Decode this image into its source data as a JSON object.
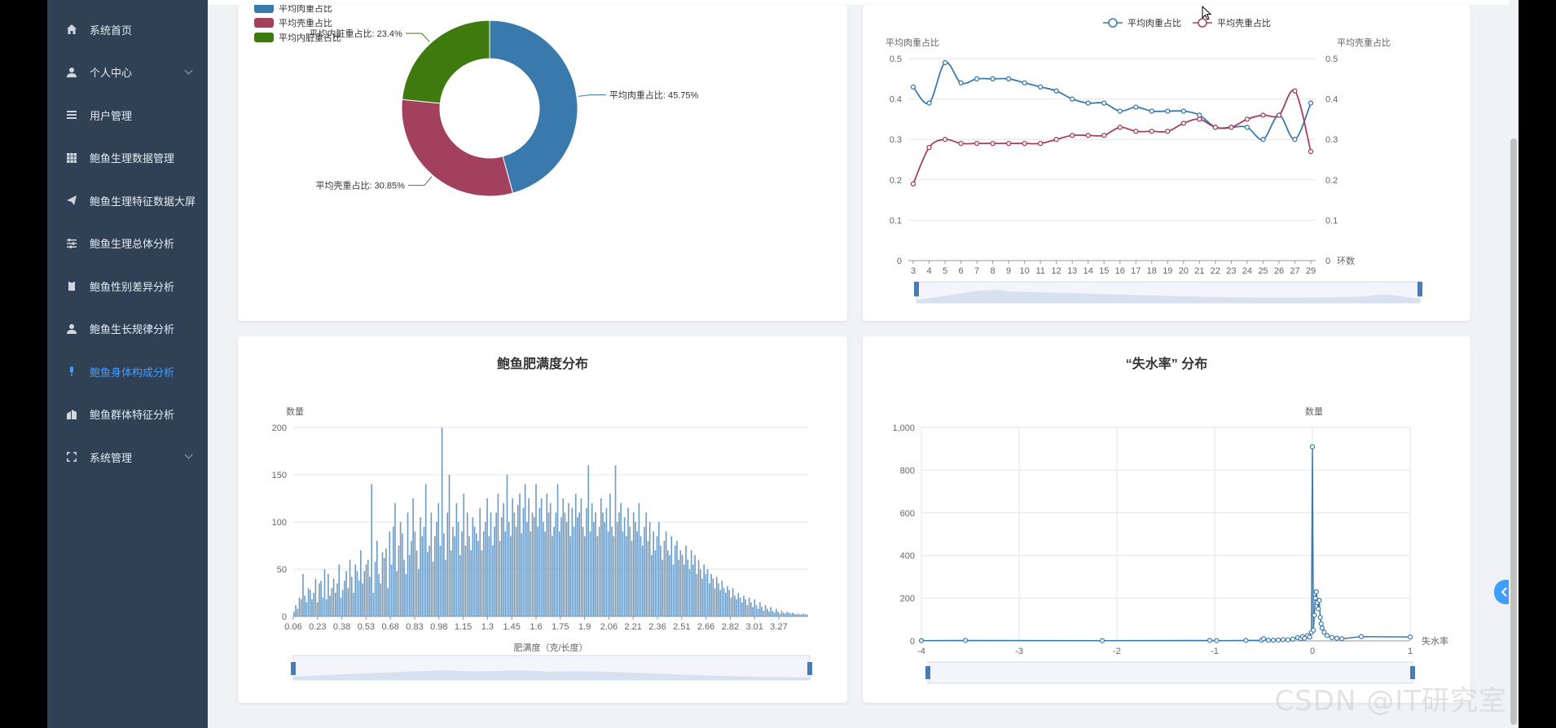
{
  "sidebar": {
    "items": [
      {
        "label": "系统首页",
        "icon": "home-icon",
        "active": false,
        "expandable": false
      },
      {
        "label": "个人中心",
        "icon": "user-icon",
        "active": false,
        "expandable": true
      },
      {
        "label": "用户管理",
        "icon": "list-icon",
        "active": false,
        "expandable": false
      },
      {
        "label": "鲍鱼生理数据管理",
        "icon": "grid-icon",
        "active": false,
        "expandable": false
      },
      {
        "label": "鲍鱼生理特征数据大屏",
        "icon": "paper-plane-icon",
        "active": false,
        "expandable": false
      },
      {
        "label": "鲍鱼生理总体分析",
        "icon": "sliders-icon",
        "active": false,
        "expandable": false
      },
      {
        "label": "鲍鱼性别差异分析",
        "icon": "clipboard-icon",
        "active": false,
        "expandable": false
      },
      {
        "label": "鲍鱼生长规律分析",
        "icon": "user-icon",
        "active": false,
        "expandable": false
      },
      {
        "label": "鲍鱼身体构成分析",
        "icon": "microphone-icon",
        "active": true,
        "expandable": false
      },
      {
        "label": "鲍鱼群体特征分析",
        "icon": "building-icon",
        "active": false,
        "expandable": false
      },
      {
        "label": "系统管理",
        "icon": "fullscreen-icon",
        "active": false,
        "expandable": true
      }
    ]
  },
  "colors": {
    "sidebar_bg": "#304156",
    "accent": "#409EFF",
    "series_blue": "#3a79ab",
    "series_red": "#a3405e",
    "series_green": "#3f7a0f"
  },
  "charts": {
    "pie": {
      "legend": [
        "平均肉重占比",
        "平均壳重占比",
        "平均内脏重占比"
      ]
    },
    "line": {
      "legend": [
        "平均肉重占比",
        "平均壳重占比"
      ],
      "y_left_label": "平均肉重占比",
      "y_right_label": "平均壳重占比",
      "x_axis_label": "环数"
    },
    "hist": {
      "title": "鲍鱼肥满度分布",
      "ylabel": "数量",
      "xlabel": "肥满度（克/长度）"
    },
    "scatter": {
      "title": "“失水率” 分布",
      "ylabel": "数量",
      "xlabel": "失水率"
    }
  },
  "chart_data": [
    {
      "type": "pie",
      "slices": [
        {
          "name": "平均肉重占比",
          "value": 45.75,
          "label": "平均肉重占比: 45.75%"
        },
        {
          "name": "平均壳重占比",
          "value": 30.85,
          "label": "平均壳重占比: 30.85%"
        },
        {
          "name": "平均内脏重占比",
          "value": 23.4,
          "label": "平均内脏重占比: 23.4%"
        }
      ]
    },
    {
      "type": "line",
      "x": [
        "3",
        "4",
        "5",
        "6",
        "7",
        "8",
        "9",
        "10",
        "11",
        "12",
        "13",
        "14",
        "15",
        "16",
        "17",
        "18",
        "19",
        "20",
        "21",
        "22",
        "23",
        "24",
        "25",
        "26",
        "27",
        "29"
      ],
      "series": [
        {
          "name": "平均肉重占比",
          "values": [
            0.43,
            0.39,
            0.49,
            0.44,
            0.45,
            0.45,
            0.45,
            0.44,
            0.43,
            0.42,
            0.4,
            0.39,
            0.39,
            0.37,
            0.38,
            0.37,
            0.37,
            0.37,
            0.36,
            0.33,
            0.33,
            0.33,
            0.3,
            0.36,
            0.3,
            0.39
          ]
        },
        {
          "name": "平均壳重占比",
          "values": [
            0.19,
            0.28,
            0.3,
            0.29,
            0.29,
            0.29,
            0.29,
            0.29,
            0.29,
            0.3,
            0.31,
            0.31,
            0.31,
            0.33,
            0.32,
            0.32,
            0.32,
            0.34,
            0.35,
            0.33,
            0.33,
            0.35,
            0.36,
            0.36,
            0.42,
            0.27
          ]
        }
      ],
      "ylim": [
        0,
        0.5
      ],
      "yticks": [
        "0",
        "0.1",
        "0.2",
        "0.3",
        "0.4",
        "0.5"
      ]
    },
    {
      "type": "bar",
      "title": "鲍鱼肥满度分布",
      "xlabel": "肥满度（克/长度）",
      "ylabel": "数量",
      "ylim": [
        0,
        200
      ],
      "yticks": [
        "0",
        "50",
        "100",
        "150",
        "200"
      ],
      "xticks": [
        "0.06",
        "0.23",
        "0.38",
        "0.53",
        "0.68",
        "0.83",
        "0.98",
        "1.15",
        "1.3",
        "1.45",
        "1.6",
        "1.75",
        "1.9",
        "2.06",
        "2.21",
        "2.36",
        "2.51",
        "2.66",
        "2.82",
        "3.01",
        "3.27"
      ],
      "values": [
        5,
        12,
        8,
        20,
        18,
        45,
        22,
        15,
        30,
        28,
        18,
        25,
        40,
        15,
        35,
        38,
        20,
        50,
        18,
        45,
        22,
        30,
        40,
        25,
        35,
        55,
        20,
        28,
        38,
        48,
        30,
        60,
        42,
        25,
        55,
        48,
        38,
        70,
        35,
        48,
        55,
        60,
        42,
        140,
        25,
        58,
        80,
        45,
        35,
        68,
        62,
        72,
        30,
        90,
        55,
        95,
        120,
        48,
        75,
        100,
        88,
        60,
        45,
        110,
        65,
        80,
        125,
        90,
        70,
        50,
        105,
        85,
        95,
        140,
        68,
        75,
        110,
        58,
        85,
        100,
        120,
        75,
        200,
        88,
        60,
        110,
        150,
        70,
        95,
        85,
        120,
        100,
        65,
        90,
        130,
        75,
        110,
        85,
        70,
        105,
        95,
        88,
        80,
        115,
        70,
        90,
        100,
        125,
        85,
        110,
        75,
        95,
        110,
        130,
        80,
        105,
        120,
        90,
        150,
        100,
        85,
        125,
        110,
        95,
        118,
        130,
        88,
        115,
        140,
        100,
        125,
        90,
        110,
        105,
        140,
        95,
        115,
        125,
        100,
        90,
        130,
        110,
        120,
        85,
        95,
        110,
        140,
        90,
        105,
        125,
        110,
        100,
        120,
        85,
        115,
        95,
        130,
        105,
        110,
        125,
        95,
        85,
        115,
        160,
        90,
        120,
        100,
        110,
        85,
        95,
        125,
        110,
        100,
        115,
        90,
        130,
        95,
        85,
        160,
        100,
        110,
        120,
        90,
        105,
        85,
        115,
        95,
        80,
        110,
        100,
        90,
        120,
        85,
        75,
        95,
        110,
        80,
        100,
        65,
        90,
        70,
        85,
        100,
        75,
        60,
        80,
        90,
        70,
        65,
        85,
        55,
        75,
        80,
        60,
        70,
        65,
        55,
        75,
        60,
        50,
        70,
        55,
        65,
        45,
        60,
        50,
        40,
        55,
        45,
        50,
        35,
        45,
        40,
        30,
        42,
        35,
        28,
        38,
        30,
        25,
        32,
        28,
        20,
        30,
        22,
        18,
        25,
        20,
        15,
        22,
        18,
        12,
        20,
        15,
        10,
        18,
        12,
        8,
        15,
        10,
        6,
        12,
        8,
        5,
        10,
        6,
        4,
        8,
        5,
        3,
        6,
        4,
        3,
        5,
        4,
        3,
        4,
        3,
        2,
        3,
        2,
        2,
        3,
        2,
        2
      ]
    },
    {
      "type": "scatter",
      "title": "“失水率” 分布",
      "xlabel": "失水率",
      "ylabel": "数量",
      "xlim": [
        -4,
        1
      ],
      "ylim": [
        0,
        1000
      ],
      "xticks": [
        "-4",
        "-3",
        "-2",
        "-1",
        "0",
        "1"
      ],
      "yticks": [
        "0",
        "200",
        "400",
        "600",
        "800",
        "1,000"
      ],
      "points": [
        [
          -4,
          1
        ],
        [
          -3.55,
          2
        ],
        [
          -2.15,
          1
        ],
        [
          -1.05,
          2
        ],
        [
          -0.98,
          1
        ],
        [
          -0.68,
          2
        ],
        [
          -0.52,
          3
        ],
        [
          -0.5,
          10
        ],
        [
          -0.45,
          3
        ],
        [
          -0.4,
          3
        ],
        [
          -0.35,
          4
        ],
        [
          -0.3,
          6
        ],
        [
          -0.25,
          5
        ],
        [
          -0.2,
          8
        ],
        [
          -0.15,
          15
        ],
        [
          -0.12,
          10
        ],
        [
          -0.1,
          20
        ],
        [
          -0.08,
          12
        ],
        [
          -0.05,
          25
        ],
        [
          -0.03,
          18
        ],
        [
          -0.01,
          40
        ],
        [
          0,
          910
        ],
        [
          0.01,
          50
        ],
        [
          0.02,
          120
        ],
        [
          0.03,
          200
        ],
        [
          0.04,
          230
        ],
        [
          0.05,
          180
        ],
        [
          0.06,
          150
        ],
        [
          0.07,
          190
        ],
        [
          0.08,
          110
        ],
        [
          0.09,
          80
        ],
        [
          0.1,
          60
        ],
        [
          0.12,
          40
        ],
        [
          0.15,
          25
        ],
        [
          0.2,
          15
        ],
        [
          0.25,
          12
        ],
        [
          0.3,
          10
        ],
        [
          0.5,
          20
        ],
        [
          1,
          18
        ]
      ]
    }
  ],
  "watermark": "CSDN @IT研究室"
}
